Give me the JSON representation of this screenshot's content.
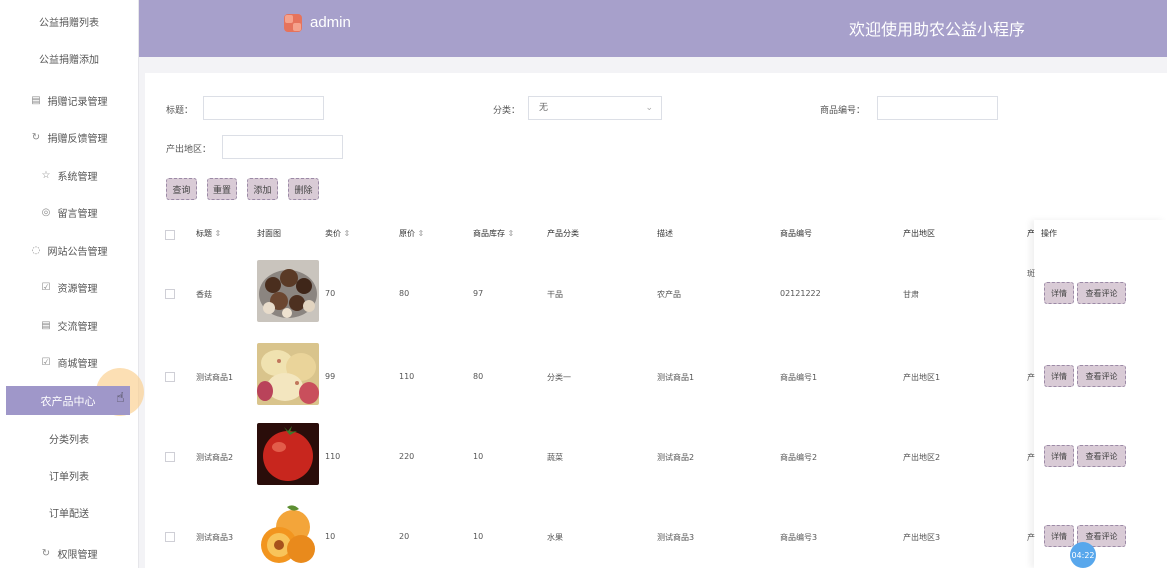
{
  "sidebar": {
    "items": [
      {
        "label": "公益捐赠列表",
        "icon": ""
      },
      {
        "label": "公益捐赠添加",
        "icon": ""
      },
      {
        "label": "捐赠记录管理",
        "icon": "archive-icon"
      },
      {
        "label": "捐赠反馈管理",
        "icon": "refresh-icon"
      },
      {
        "label": "系统管理",
        "icon": "star-icon"
      },
      {
        "label": "留言管理",
        "icon": "compass-icon"
      },
      {
        "label": "网站公告管理",
        "icon": "broadcast-icon"
      },
      {
        "label": "资源管理",
        "icon": "checkbox-icon"
      },
      {
        "label": "交流管理",
        "icon": "archive-icon"
      },
      {
        "label": "商城管理",
        "icon": "checkbox-icon"
      },
      {
        "label": "农产品中心",
        "icon": ""
      },
      {
        "label": "分类列表",
        "icon": ""
      },
      {
        "label": "订单列表",
        "icon": ""
      },
      {
        "label": "订单配送",
        "icon": ""
      },
      {
        "label": "权限管理",
        "icon": "refresh-icon"
      }
    ]
  },
  "header": {
    "app_name": "admin",
    "welcome": "欢迎使用助农公益小程序"
  },
  "search": {
    "title_label": "标题：",
    "category_label": "分类：",
    "category_value": "无",
    "product_no_label": "商品编号：",
    "region_label": "产出地区："
  },
  "actions": {
    "query": "查询",
    "reset": "重置",
    "add": "添加",
    "delete": "删除"
  },
  "table": {
    "headers": [
      "标题",
      "封面图",
      "卖价",
      "原价",
      "商品库存",
      "产品分类",
      "描述",
      "商品编号",
      "产出地区",
      "产",
      "操作"
    ],
    "rows": [
      {
        "title": "香菇",
        "price": "70",
        "orig": "80",
        "stock": "97",
        "category": "干品",
        "desc": "农产品",
        "no": "02121222",
        "region": "甘肃",
        "extra": "斑",
        "thumb": "mushroom"
      },
      {
        "title": "测试商品1",
        "price": "99",
        "orig": "110",
        "stock": "80",
        "category": "分类一",
        "desc": "测试商品1",
        "no": "商品编号1",
        "region": "产出地区1",
        "extra": "产",
        "thumb": "potato"
      },
      {
        "title": "测试商品2",
        "price": "110",
        "orig": "220",
        "stock": "10",
        "category": "蔬菜",
        "desc": "测试商品2",
        "no": "商品编号2",
        "region": "产出地区2",
        "extra": "产",
        "thumb": "tomato"
      },
      {
        "title": "测试商品3",
        "price": "10",
        "orig": "20",
        "stock": "10",
        "category": "水果",
        "desc": "测试商品3",
        "no": "商品编号3",
        "region": "产出地区3",
        "extra": "产",
        "thumb": "apricot"
      }
    ],
    "op_detail": "详情",
    "op_comments": "查看评论"
  },
  "timer": "04:22",
  "colors": {
    "primary": "#a7a0cb",
    "active": "#9f97c9",
    "button": "#d9cbd6"
  }
}
